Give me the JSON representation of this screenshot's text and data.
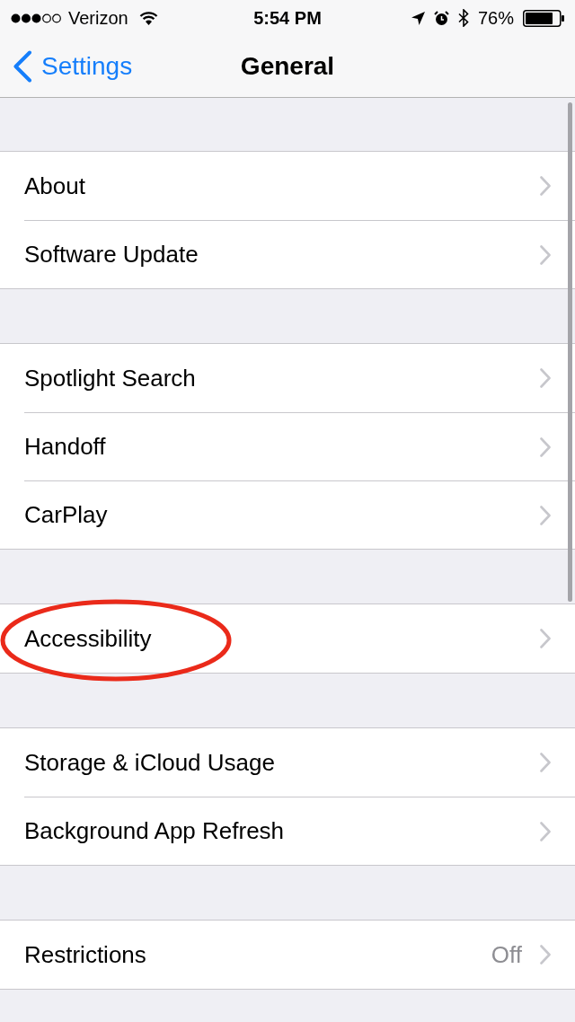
{
  "status_bar": {
    "carrier": "Verizon",
    "time": "5:54 PM",
    "battery": "76%"
  },
  "nav_bar": {
    "back": "Settings",
    "title": "General"
  },
  "groups": [
    {
      "rows": [
        {
          "label": "About",
          "circled": false
        },
        {
          "label": "Software Update",
          "circled": false
        }
      ]
    },
    {
      "rows": [
        {
          "label": "Spotlight Search",
          "circled": false
        },
        {
          "label": "Handoff",
          "circled": false
        },
        {
          "label": "CarPlay",
          "circled": false
        }
      ]
    },
    {
      "rows": [
        {
          "label": "Accessibility",
          "circled": true
        }
      ]
    },
    {
      "rows": [
        {
          "label": "Storage & iCloud Usage",
          "circled": false
        },
        {
          "label": "Background App Refresh",
          "circled": false
        }
      ]
    },
    {
      "rows": [
        {
          "label": "Restrictions",
          "value": "Off",
          "circled": false
        }
      ]
    }
  ]
}
